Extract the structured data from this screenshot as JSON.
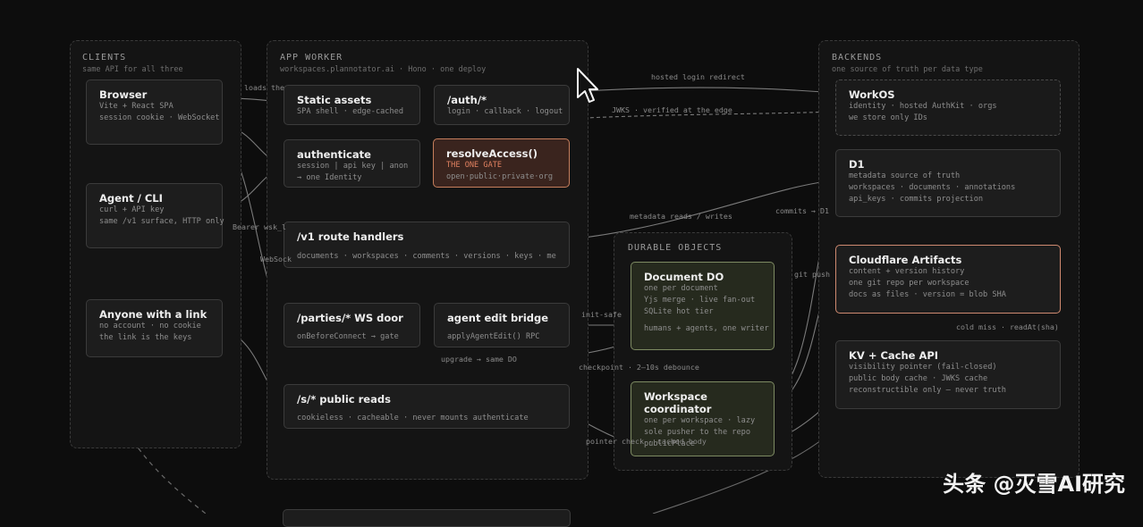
{
  "clients": {
    "title": "CLIENTS",
    "subtitle": "same API for all three",
    "browser": {
      "title": "Browser",
      "lines": [
        "Vite + React SPA",
        "session cookie · WebSocket"
      ]
    },
    "agent": {
      "title": "Agent / CLI",
      "lines": [
        "curl + API key",
        "same /v1 surface, HTTP only"
      ]
    },
    "anyone": {
      "title": "Anyone with a link",
      "lines": [
        "no account · no cookie",
        "the link is the keys"
      ]
    }
  },
  "worker": {
    "title": "APP WORKER",
    "subtitle": "workspaces.plannotator.ai · Hono · one deploy",
    "static": {
      "title": "Static assets",
      "lines": [
        "SPA shell · edge-cached"
      ]
    },
    "auth": {
      "title": "/auth/*",
      "lines": [
        "login · callback · logout"
      ]
    },
    "authenticate": {
      "title": "authenticate",
      "lines": [
        "session | api key | anon",
        "→ one Identity"
      ]
    },
    "resolve": {
      "title": "resolveAccess()",
      "lines": [
        "THE ONE GATE",
        "open·public·private·org"
      ]
    },
    "v1": {
      "title": "/v1 route handlers",
      "lines": [
        "documents · workspaces · comments · versions · keys · me"
      ]
    },
    "parties": {
      "title": "/parties/* WS door",
      "lines": [
        "onBeforeConnect → gate"
      ]
    },
    "bridge": {
      "title": "agent edit bridge",
      "lines": [
        "applyAgentEdit() RPC"
      ]
    },
    "public": {
      "title": "/s/* public reads",
      "lines": [
        "cookieless · cacheable · never mounts authenticate"
      ]
    }
  },
  "durable": {
    "title": "DURABLE OBJECTS",
    "document": {
      "title": "Document DO",
      "lines": [
        "one per document",
        "Yjs merge · live fan-out",
        "SQLite hot tier"
      ],
      "note": "humans + agents, one writer"
    },
    "coordinator": {
      "title": "Workspace coordinator",
      "lines": [
        "one per workspace · lazy",
        "sole pusher to the repo",
        "publicPlace"
      ]
    }
  },
  "backends": {
    "title": "BACKENDS",
    "subtitle": "one source of truth per data type",
    "workos": {
      "title": "WorkOS",
      "lines": [
        "identity · hosted AuthKit · orgs",
        "we store only IDs"
      ]
    },
    "d1": {
      "title": "D1",
      "lines": [
        "metadata source of truth",
        "workspaces · documents · annotations",
        "api_keys · commits projection"
      ]
    },
    "cf": {
      "title": "Cloudflare Artifacts",
      "lines": [
        "content + version history",
        "one git repo per workspace",
        "docs as files · version = blob SHA"
      ]
    },
    "kv": {
      "title": "KV + Cache API",
      "lines": [
        "visibility pointer (fail-closed)",
        "public body cache · JWKS cache",
        "reconstructible only — never truth"
      ]
    }
  },
  "edges": {
    "loads_the": "loads the",
    "hosted_login": "hosted login redirect",
    "jwks": "JWKS · verified at the edge",
    "metadata": "metadata reads / writes",
    "commits": "commits → D1",
    "bearer": "Bearer wsk_l",
    "websock": "WebSock",
    "init_safe": "init-safe",
    "upgrade": "upgrade → same DO",
    "checkpoint": "checkpoint · 2–10s debounce",
    "git_push": "git push",
    "cold_miss": "cold miss · readAt(sha)",
    "pointer_check": "pointer check · cached body"
  },
  "watermark": "头条 @灭雪AI研究"
}
